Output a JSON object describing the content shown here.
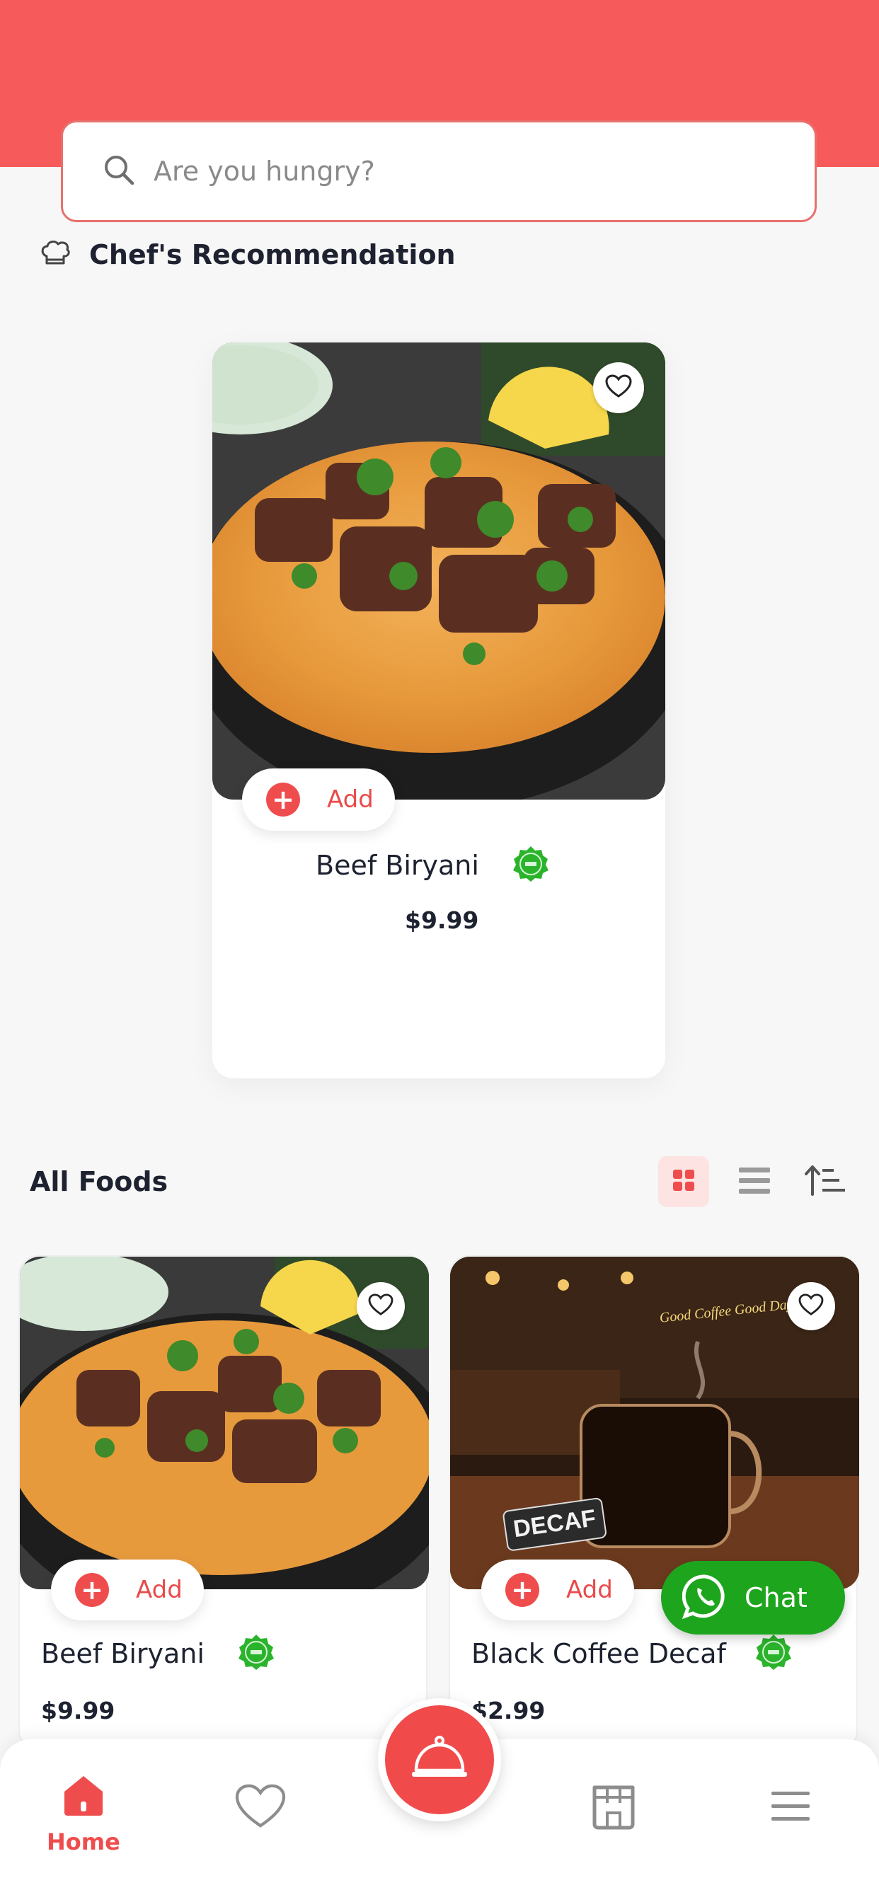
{
  "colors": {
    "brand": "#f75a5a",
    "accent": "#ef4d4d",
    "chat": "#1ea51e",
    "halal_badge": "#2bb32b"
  },
  "search": {
    "placeholder": "Are you hungry?",
    "icon": "search-icon"
  },
  "recommendation": {
    "icon": "chef-hat-icon",
    "title": "Chef's Recommendation",
    "item": {
      "name": "Beef Biryani",
      "price": "$9.99",
      "add_label": "Add",
      "image": "beef-biryani-photo",
      "badge": "halal-badge-icon"
    }
  },
  "all_foods": {
    "title": "All Foods",
    "view_icons": [
      "grid-view-icon",
      "list-view-icon",
      "sort-icon"
    ],
    "active_view": "grid",
    "items": [
      {
        "name": "Beef Biryani",
        "price": "$9.99",
        "add_label": "Add",
        "image": "beef-biryani-photo",
        "badge": "halal-badge-icon"
      },
      {
        "name": "Black Coffee Decaf",
        "price": "$2.99",
        "add_label": "Add",
        "image": "black-coffee-photo",
        "image_sign": "DECAF",
        "image_neon": "Good Coffee Good Day",
        "badge": "halal-badge-icon"
      }
    ]
  },
  "chat": {
    "label": "Chat",
    "icon": "whatsapp-icon"
  },
  "bottom_nav": {
    "items": [
      {
        "label": "Home",
        "icon": "home-icon",
        "active": true
      },
      {
        "label": "",
        "icon": "heart-icon"
      },
      {
        "label": "",
        "icon": "cloche-icon"
      },
      {
        "label": "",
        "icon": "store-icon"
      },
      {
        "label": "",
        "icon": "menu-icon"
      }
    ]
  }
}
